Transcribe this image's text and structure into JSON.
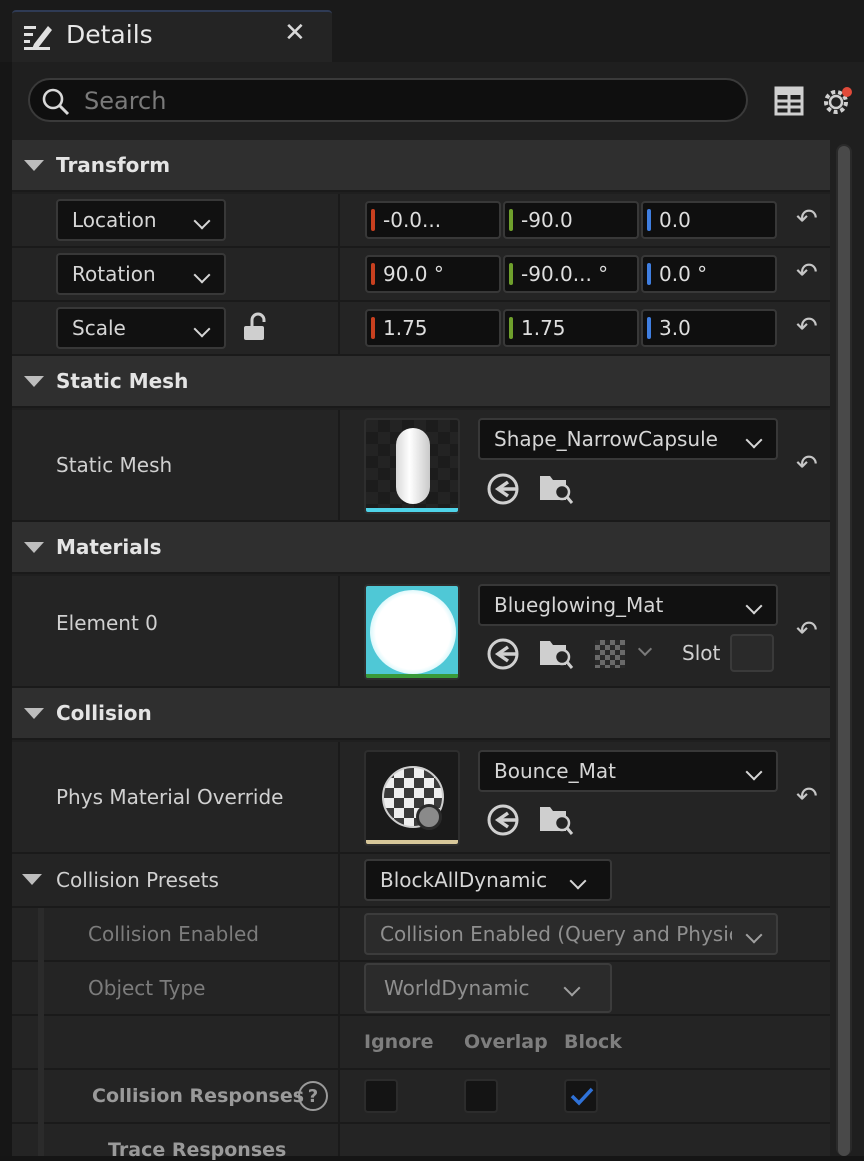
{
  "tab": {
    "title": "Details",
    "close_glyph": "✕",
    "icon": "details-pencil-icon"
  },
  "search": {
    "placeholder": "Search",
    "value": ""
  },
  "toolbar": {
    "grid_icon": "table-view-icon",
    "settings_icon": "gear-icon",
    "settings_badge_color": "#e04a3a"
  },
  "transform": {
    "header": "Transform",
    "location": {
      "label": "Location",
      "x": "-0.0...",
      "y": "-90.0",
      "z": "0.0"
    },
    "rotation": {
      "label": "Rotation",
      "x": "90.0 °",
      "y": "-90.0... °",
      "z": "0.0 °"
    },
    "scale": {
      "label": "Scale",
      "x": "1.75",
      "y": "1.75",
      "z": "3.0",
      "lock_icon": "unlock-icon"
    }
  },
  "static_mesh": {
    "header": "Static Mesh",
    "label": "Static Mesh",
    "asset": "Shape_NarrowCapsule"
  },
  "materials": {
    "header": "Materials",
    "label": "Element 0",
    "asset": "Blueglowing_Mat",
    "slot_label": "Slot"
  },
  "collision": {
    "header": "Collision",
    "phys_label": "Phys Material Override",
    "phys_asset": "Bounce_Mat",
    "presets_label": "Collision Presets",
    "presets_value": "BlockAllDynamic",
    "enabled_label": "Collision Enabled",
    "enabled_value": "Collision Enabled (Query and Physics",
    "object_type_label": "Object Type",
    "object_type_value": "WorldDynamic",
    "col_ignore": "Ignore",
    "col_overlap": "Overlap",
    "col_block": "Block",
    "responses_label": "Collision Responses",
    "responses_help": "?",
    "trace_label": "Trace Responses",
    "responses": {
      "ignore": false,
      "overlap": false,
      "block": true
    }
  },
  "colors": {
    "x_axis": "#c8401f",
    "y_axis": "#6fa02c",
    "z_axis": "#3f7ee0",
    "mesh_underline": "#4fd3e8",
    "material_underline": "#3a9a3a",
    "phys_underline": "#d8c89a"
  },
  "reset_glyph": "↶"
}
